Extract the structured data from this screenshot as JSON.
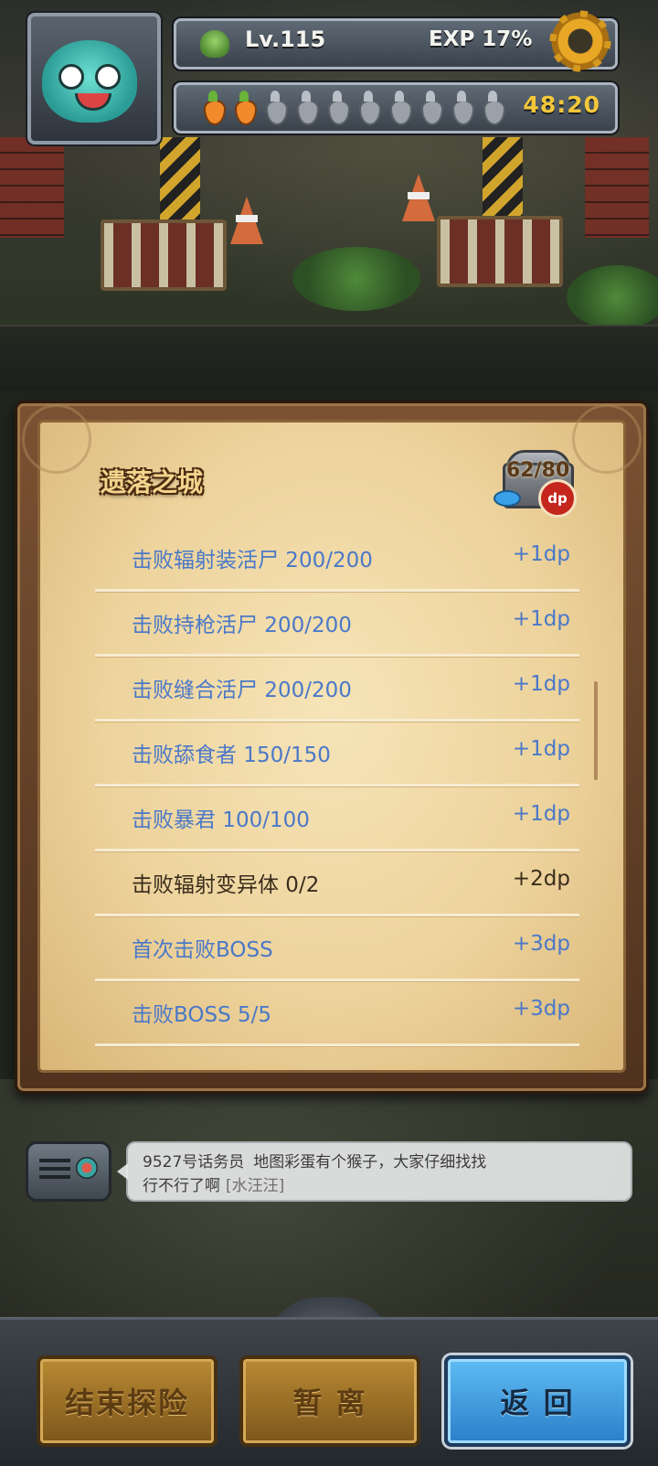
{
  "hud": {
    "level": "Lv.115",
    "exp": "EXP 17%",
    "stamina_full": 2,
    "stamina_total": 10,
    "timer": "48:20"
  },
  "panel": {
    "title": "遗落之城",
    "chest_count": "62/80",
    "chest_badge": "dp",
    "quests": [
      {
        "label": "击败辐射装活尸 200/200",
        "reward": "+1dp",
        "done": true
      },
      {
        "label": "击败持枪活尸 200/200",
        "reward": "+1dp",
        "done": true
      },
      {
        "label": "击败缝合活尸 200/200",
        "reward": "+1dp",
        "done": true
      },
      {
        "label": "击败舔食者 150/150",
        "reward": "+1dp",
        "done": true
      },
      {
        "label": "击败暴君 100/100",
        "reward": "+1dp",
        "done": true
      },
      {
        "label": "击败辐射变异体 0/2",
        "reward": "+2dp",
        "done": false
      },
      {
        "label": "首次击败BOSS",
        "reward": "+3dp",
        "done": true
      },
      {
        "label": "击败BOSS 5/5",
        "reward": "+3dp",
        "done": true
      }
    ]
  },
  "chat": {
    "sender": "9527号话务员",
    "message_line1": "地图彩蛋有个猴子，大家仔细找找",
    "message_line2": "行不行了啊",
    "emote": "[水汪汪]"
  },
  "buttons": {
    "end": "结束探险",
    "away": "暂 离",
    "back": "返 回"
  },
  "colors": {
    "completed_text": "#4a78c8",
    "pending_text": "#3a2c1c",
    "timer": "#f2c73a",
    "back_button": "#3e9de0"
  }
}
